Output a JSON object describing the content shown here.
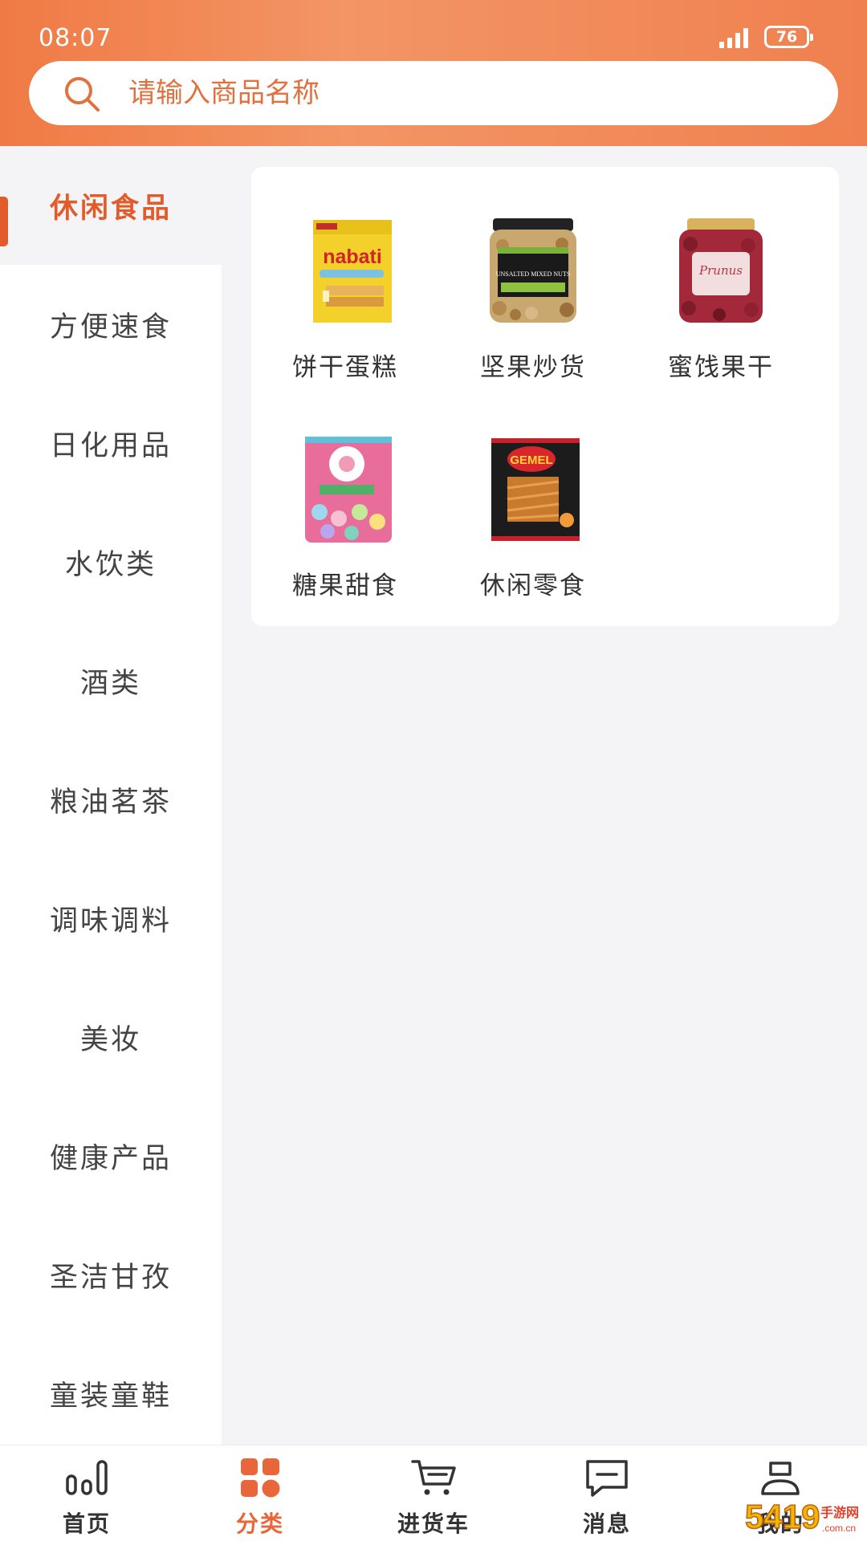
{
  "status_bar": {
    "time": "08:07",
    "battery": "76"
  },
  "search": {
    "placeholder": "请输入商品名称"
  },
  "sidebar": {
    "categories": [
      {
        "label": "休闲食品",
        "active": true
      },
      {
        "label": "方便速食"
      },
      {
        "label": "日化用品"
      },
      {
        "label": "水饮类"
      },
      {
        "label": "酒类"
      },
      {
        "label": "粮油茗茶"
      },
      {
        "label": "调味调料"
      },
      {
        "label": "美妆"
      },
      {
        "label": "健康产品"
      },
      {
        "label": "圣洁甘孜"
      },
      {
        "label": "童装童鞋"
      }
    ]
  },
  "subcategories": [
    {
      "label": "饼干蛋糕",
      "icon": "wafer-package-image",
      "brand_text": "nabati"
    },
    {
      "label": "坚果炒货",
      "icon": "mixed-nuts-jar-image",
      "brand_text": "UNSALTED MIXED NUTS"
    },
    {
      "label": "蜜饯果干",
      "icon": "dried-fruit-jar-image",
      "brand_text": "Prunus"
    },
    {
      "label": "糖果甜食",
      "icon": "candy-bag-image"
    },
    {
      "label": "休闲零食",
      "icon": "snack-bag-image",
      "brand_text": "GEMEL"
    }
  ],
  "bottom_nav": [
    {
      "label": "首页",
      "icon": "home-chart-icon"
    },
    {
      "label": "分类",
      "icon": "category-grid-icon",
      "active": true
    },
    {
      "label": "进货车",
      "icon": "cart-icon"
    },
    {
      "label": "消息",
      "icon": "message-icon"
    },
    {
      "label": "我的",
      "icon": "profile-icon"
    }
  ],
  "colors": {
    "accent": "#e8663a",
    "header_start": "#f07a45",
    "header_end": "#f0804f"
  },
  "watermark": {
    "text": "手游网"
  }
}
